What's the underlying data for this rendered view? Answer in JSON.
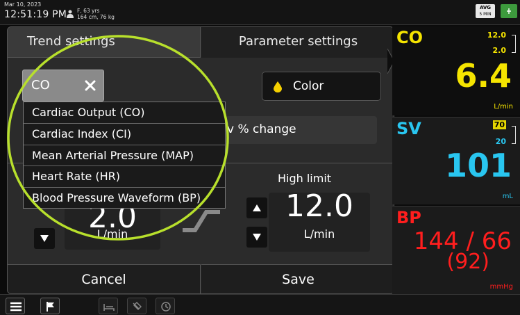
{
  "status_bar": {
    "date": "Mar 10, 2023",
    "time": "12:51:19 PM",
    "patient_line1": "F, 63 yrs",
    "patient_line2": "164 cm, 76 kg",
    "avg_label": "AVG",
    "avg_interval": "5 MIN"
  },
  "tabs": {
    "trend_settings": "Trend settings",
    "parameter_settings": "Parameter settings"
  },
  "parameter_select": {
    "selected": "CO",
    "options": [
      "Cardiac Output (CO)",
      "Cardiac Index (CI)",
      "Mean Arterial Pressure (MAP)",
      "Heart Rate (HR)",
      "Blood Pressure Waveform (BP)"
    ]
  },
  "color_button": {
    "label": "Color",
    "swatch": "#f5d000"
  },
  "percent_change": {
    "label": "v % change"
  },
  "high_limit": {
    "label": "High limit",
    "value": "12.0",
    "unit": "L/min"
  },
  "low_limit": {
    "value": "2.0",
    "unit": "L/min"
  },
  "actions": {
    "cancel": "Cancel",
    "save": "Save"
  },
  "tiles": {
    "co": {
      "name": "CO",
      "high": "12.0",
      "low": "2.0",
      "value": "6.4",
      "unit": "L/min",
      "color": "#f5e400"
    },
    "sv": {
      "name": "SV",
      "high": "70",
      "low": "20",
      "value": "101",
      "unit": "mL",
      "color": "#29c6f0"
    },
    "bp": {
      "name": "BP",
      "value": "144 / 66",
      "map": "(92)",
      "unit": "mmHg",
      "color": "#ff1e1e"
    }
  },
  "colors": {
    "highlight_ring": "#b8e02c",
    "accent_green": "#3d9a3d"
  }
}
